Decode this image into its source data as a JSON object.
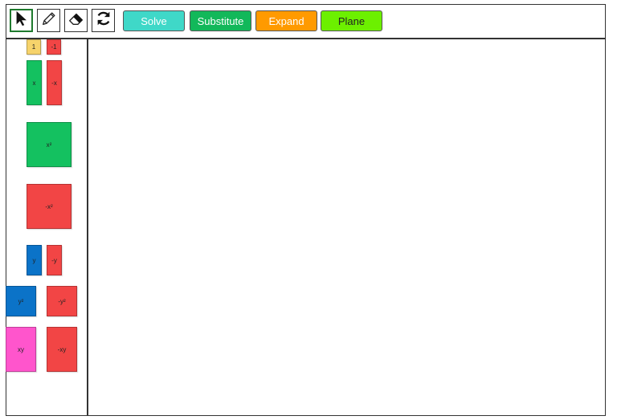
{
  "toolbar": {
    "tools": [
      {
        "name": "select-tool",
        "icon": "arrow-pointer-icon",
        "selected": true
      },
      {
        "name": "pencil-tool",
        "icon": "pencil-icon",
        "selected": false
      },
      {
        "name": "eraser-tool",
        "icon": "eraser-icon",
        "selected": false
      },
      {
        "name": "refresh-tool",
        "icon": "refresh-icon",
        "selected": false
      }
    ],
    "buttons": {
      "solve": {
        "label": "Solve",
        "color": "#3fd8c8"
      },
      "substitute": {
        "label": "Substitute",
        "color": "#12b85a"
      },
      "expand": {
        "label": "Expand",
        "color": "#ff9a00"
      },
      "plane": {
        "label": "Plane",
        "color": "#6cf000"
      }
    }
  },
  "tiles": {
    "one": {
      "label": "1",
      "color": "#f6d36b"
    },
    "neg_one": {
      "label": "-1",
      "color": "#f24545"
    },
    "x": {
      "label": "x",
      "color": "#14c160"
    },
    "neg_x": {
      "label": "-x",
      "color": "#f24545"
    },
    "x2": {
      "label": "x²",
      "color": "#14c160"
    },
    "neg_x2": {
      "label": "-x²",
      "color": "#f24545"
    },
    "y": {
      "label": "y",
      "color": "#0b73c8"
    },
    "neg_y": {
      "label": "-y",
      "color": "#f24545"
    },
    "y2": {
      "label": "y²",
      "color": "#0b73c8"
    },
    "neg_y2": {
      "label": "-y²",
      "color": "#f24545"
    },
    "xy": {
      "label": "xy",
      "color": "#ff55cc"
    },
    "neg_xy": {
      "label": "-xy",
      "color": "#f24545"
    }
  }
}
